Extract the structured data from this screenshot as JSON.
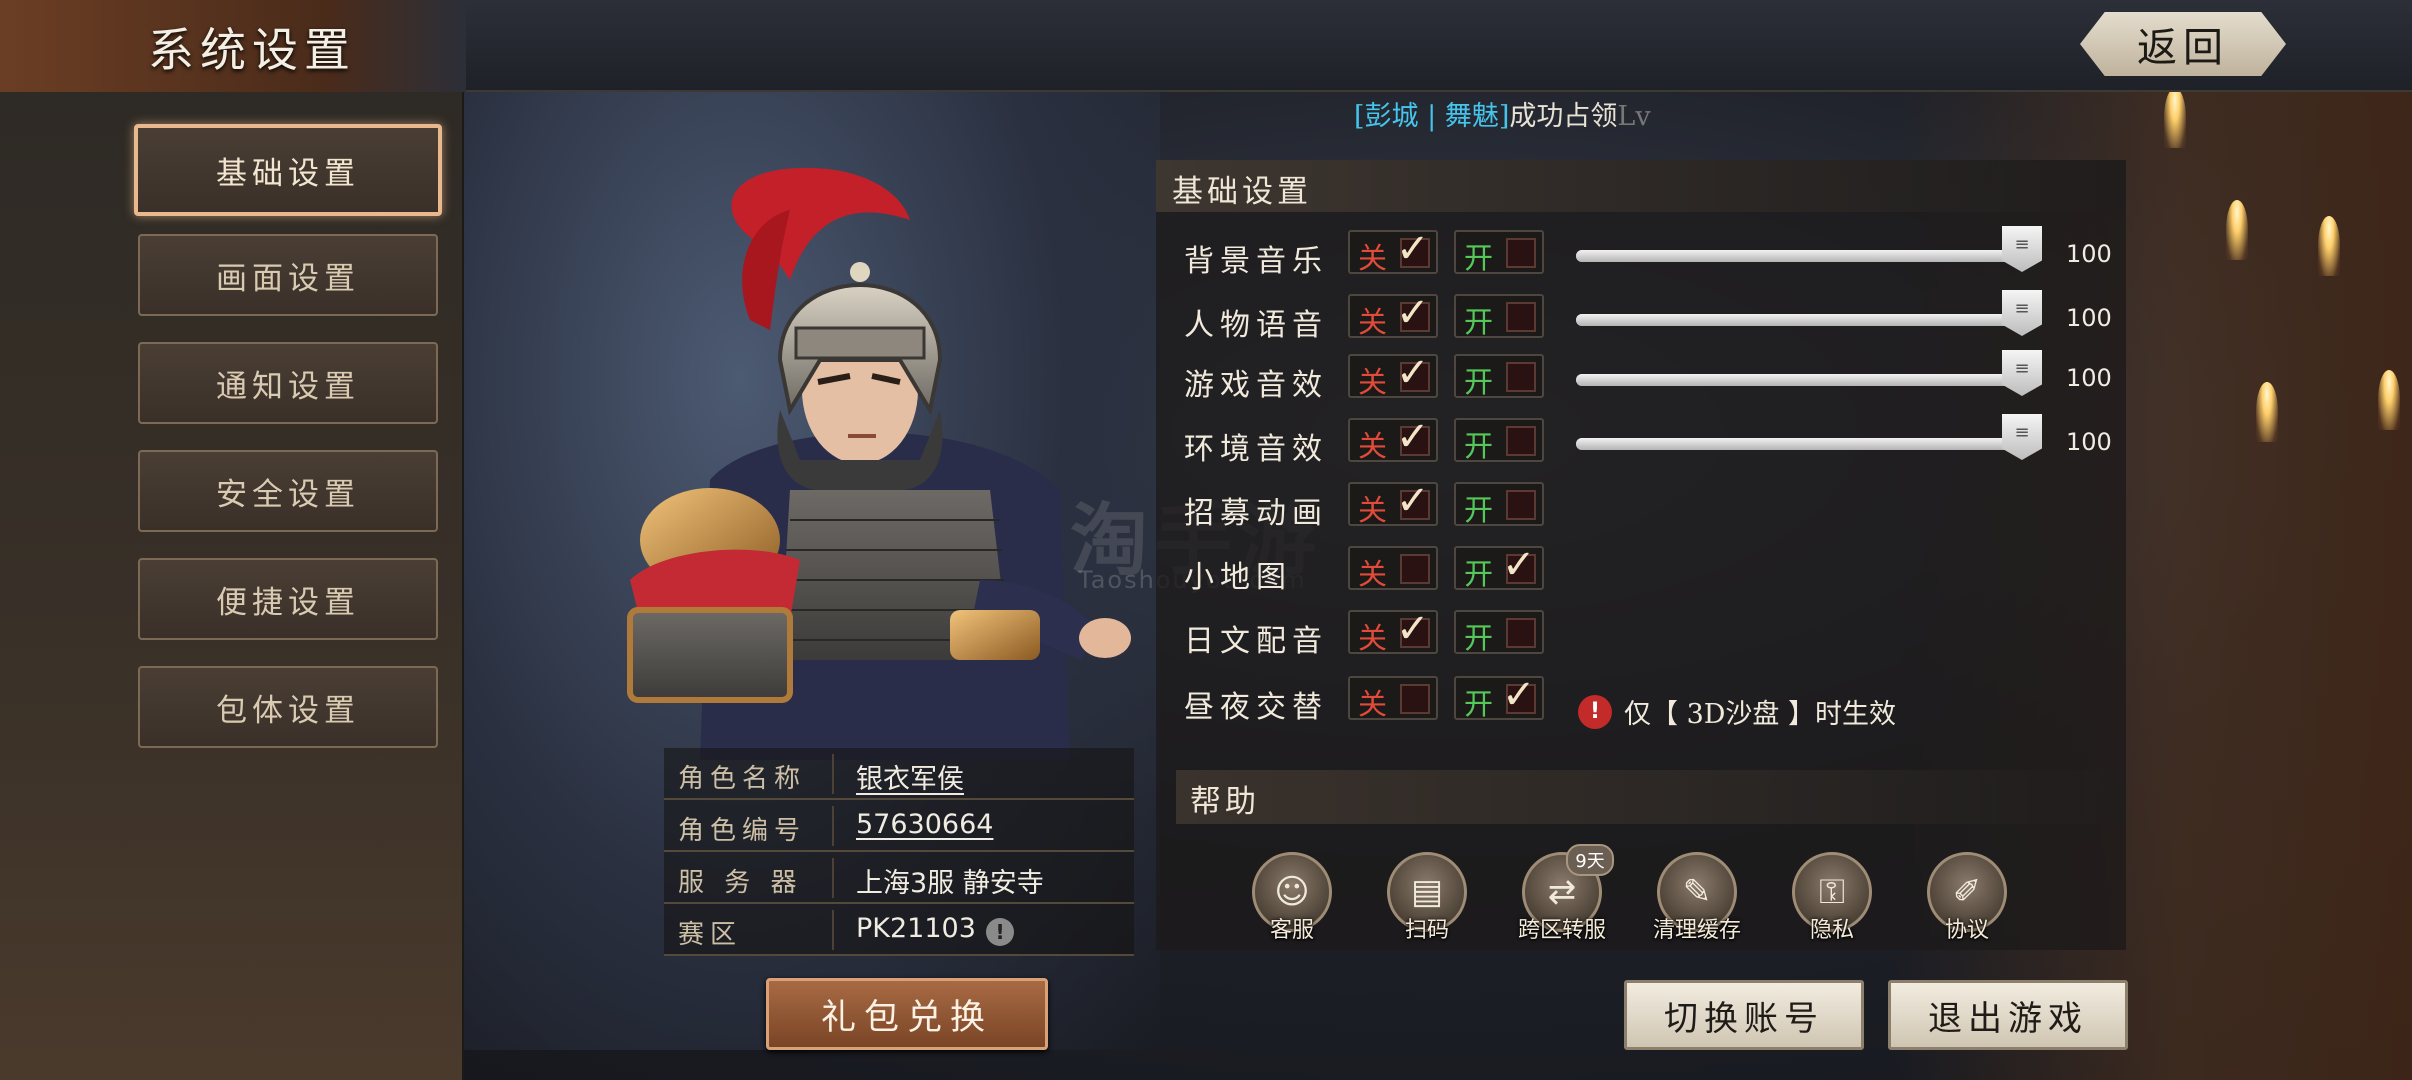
{
  "header": {
    "title": "系统设置",
    "back_label": "返回",
    "ticker": {
      "open": "[",
      "place": "彭城",
      "divider": "|",
      "player": "舞魅",
      "close": "]",
      "message": "成功占领",
      "trail": "Lv"
    }
  },
  "sidebar": {
    "items": [
      {
        "label": "基础设置",
        "active": true
      },
      {
        "label": "画面设置",
        "active": false
      },
      {
        "label": "通知设置",
        "active": false
      },
      {
        "label": "安全设置",
        "active": false
      },
      {
        "label": "便捷设置",
        "active": false
      },
      {
        "label": "包体设置",
        "active": false
      }
    ]
  },
  "watermark": {
    "main": "淘手游",
    "sub": "Taoshouyou.com"
  },
  "profile": {
    "rows": [
      {
        "label": "角色名称",
        "value": "银衣军侯"
      },
      {
        "label": "角色编号",
        "value": "57630664"
      },
      {
        "label": "服 务 器",
        "value": "上海3服 静安寺"
      },
      {
        "label": "赛区",
        "value": "PK21103"
      }
    ],
    "alert_glyph": "!",
    "gift_button": "礼包兑换"
  },
  "basic": {
    "title": "基础设置",
    "off_label": "关",
    "on_label": "开",
    "settings": [
      {
        "label": "背景音乐",
        "enabled": false,
        "volume": 100
      },
      {
        "label": "人物语音",
        "enabled": false,
        "volume": 100
      },
      {
        "label": "游戏音效",
        "enabled": false,
        "volume": 100
      },
      {
        "label": "环境音效",
        "enabled": false,
        "volume": 100
      },
      {
        "label": "招募动画",
        "enabled": false
      },
      {
        "label": "小地图",
        "enabled": true
      },
      {
        "label": "日文配音",
        "enabled": false
      },
      {
        "label": "昼夜交替",
        "enabled": true
      }
    ],
    "note": "仅【 3D沙盘 】时生效",
    "note_glyph": "!"
  },
  "help": {
    "title": "帮助",
    "items": [
      {
        "label": "客服",
        "icon": "customer-service-icon",
        "glyph": "☺"
      },
      {
        "label": "扫码",
        "icon": "scan-icon",
        "glyph": "▤"
      },
      {
        "label": "跨区转服",
        "icon": "server-transfer-icon",
        "glyph": "⇄",
        "badge": "9天"
      },
      {
        "label": "清理缓存",
        "icon": "broom-icon",
        "glyph": "✎"
      },
      {
        "label": "隐私",
        "icon": "lock-icon",
        "glyph": "⚿"
      },
      {
        "label": "协议",
        "icon": "pen-icon",
        "glyph": "✐"
      }
    ]
  },
  "actions": {
    "switch_account": "切换账号",
    "exit_game": "退出游戏"
  },
  "colors": {
    "active_border": "#e9b88c",
    "off": "#e04b3a",
    "on": "#55c85a",
    "link": "#46c4ec"
  }
}
